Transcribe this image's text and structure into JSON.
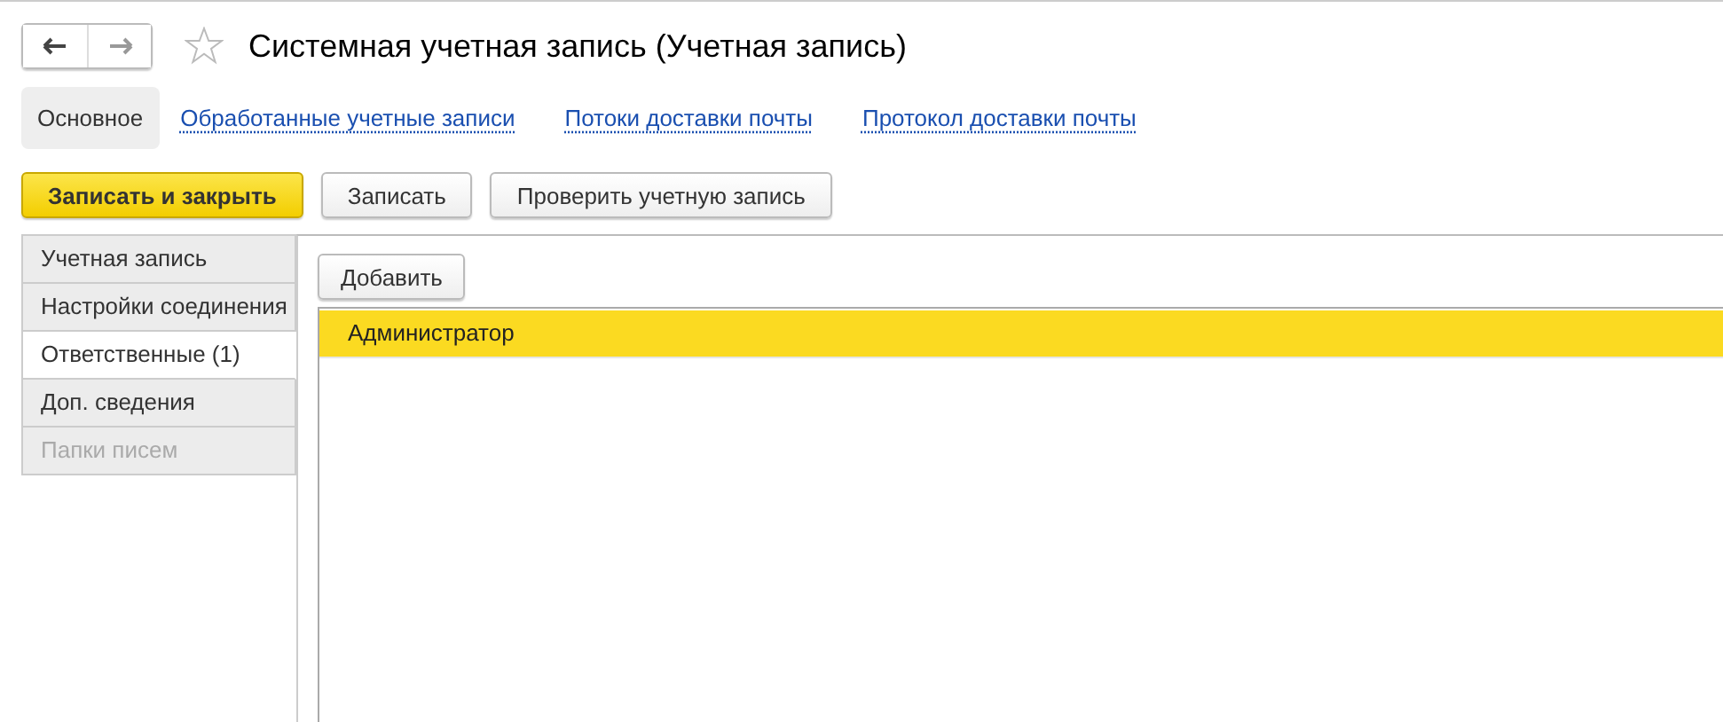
{
  "nav_buttons": [
    {
      "kind": "back",
      "disabled": false
    },
    {
      "kind": "forward",
      "disabled": true
    }
  ],
  "favorite": false,
  "window": {
    "title": "Системная учетная запись (Учетная запись)"
  },
  "sections": [
    {
      "label": "Основное",
      "selected": true
    },
    {
      "label": "Обработанные учетные записи",
      "selected": false
    },
    {
      "label": "Потоки доставки почты",
      "selected": false
    },
    {
      "label": "Протокол доставки почты",
      "selected": false
    }
  ],
  "toolbar": [
    {
      "label": "Записать и закрыть",
      "kind": "primary"
    },
    {
      "label": "Записать",
      "kind": "normal"
    },
    {
      "label": "Проверить учетную запись",
      "kind": "normal"
    }
  ],
  "tabs": [
    {
      "label": "Учетная запись",
      "selected": false,
      "disabled": false
    },
    {
      "label": "Настройки соединения",
      "selected": false,
      "disabled": false
    },
    {
      "label": "Ответственные (1)",
      "selected": true,
      "disabled": false
    },
    {
      "label": "Доп. сведения",
      "selected": false,
      "disabled": false
    },
    {
      "label": "Папки писем",
      "selected": false,
      "disabled": true
    }
  ],
  "panel": {
    "add_button": "Добавить",
    "rows": [
      {
        "name": "Администратор",
        "selected": true
      }
    ]
  }
}
